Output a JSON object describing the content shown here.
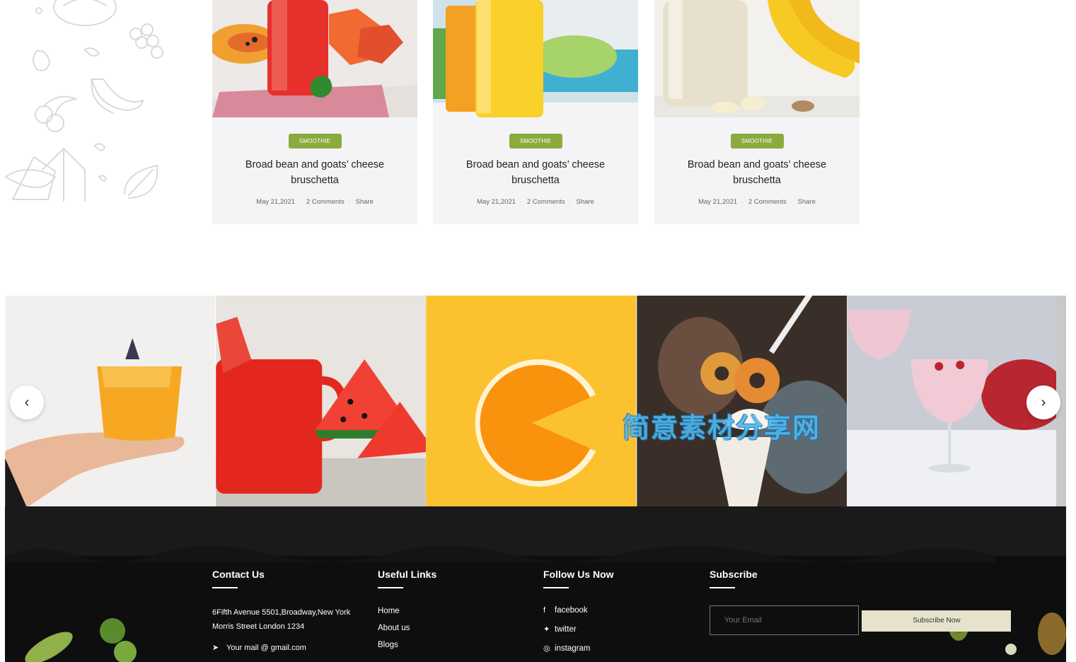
{
  "cards": [
    {
      "tag": "SMOOTHIE",
      "title": "Broad bean and goats’ cheese bruschetta",
      "date": "May 21,2021",
      "comments": "2 Comments",
      "share": "Share"
    },
    {
      "tag": "SMOOTHIE",
      "title": "Broad bean and goats’ cheese bruschetta",
      "date": "May 21,2021",
      "comments": "2 Comments",
      "share": "Share"
    },
    {
      "tag": "SMOOTHIE",
      "title": "Broad bean and goats’ cheese bruschetta",
      "date": "May 21,2021",
      "comments": "2 Comments",
      "share": "Share"
    }
  ],
  "carousel": {
    "prev": "‹",
    "next": "›"
  },
  "watermark": "简意素材分享网",
  "footer": {
    "contact": {
      "heading": "Contact Us",
      "address_line1": "6Fifth Avenue 5501,Broadway,New York",
      "address_line2": "Morris Street London 1234",
      "email": "Your mail @ gmail.com"
    },
    "links": {
      "heading": "Useful Links",
      "items": [
        "Home",
        "About us",
        "Blogs"
      ]
    },
    "follow": {
      "heading": "Follow Us Now",
      "items": [
        {
          "icon": "facebook-icon",
          "label": "facebook"
        },
        {
          "icon": "twitter-icon",
          "label": "twitter"
        },
        {
          "icon": "instagram-icon",
          "label": "instagram"
        }
      ]
    },
    "subscribe": {
      "heading": "Subscribe",
      "placeholder": "Your Email",
      "button": "Subscribe Now"
    }
  },
  "colors": {
    "tag_green": "#8aab3e",
    "footer_bg": "#0e0e0e",
    "card_bg": "#f4f4f7",
    "button_cream": "#e6e2cc"
  }
}
